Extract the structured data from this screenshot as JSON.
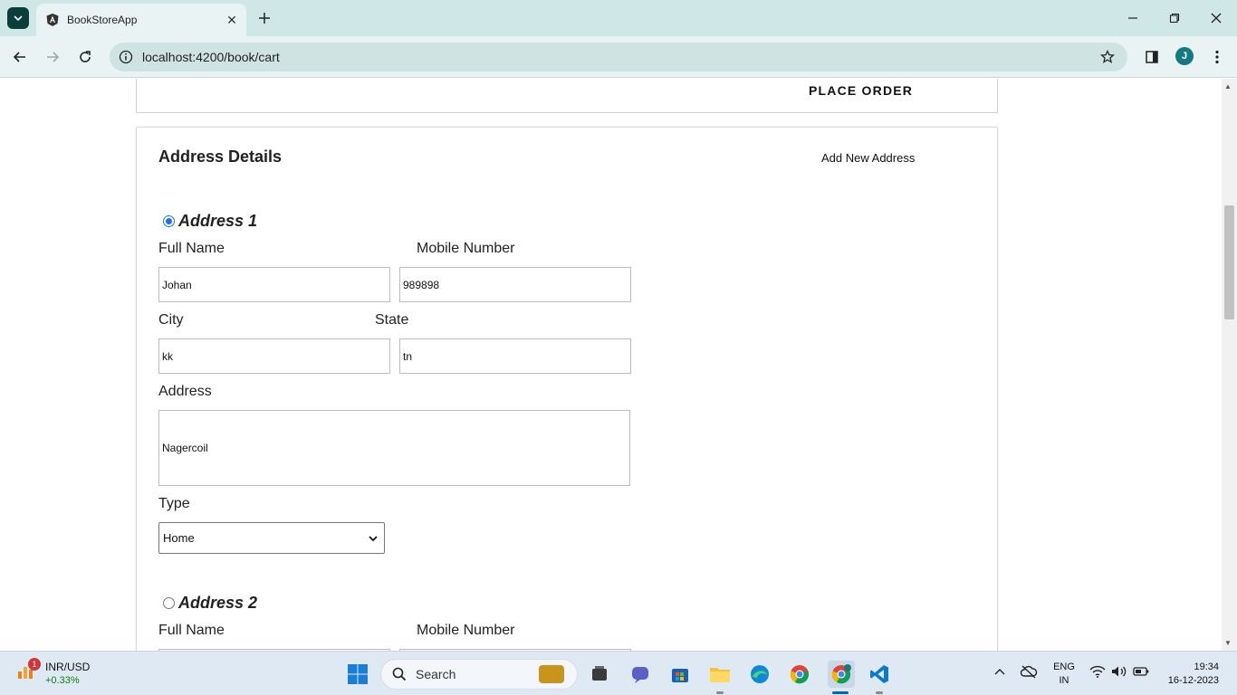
{
  "browser": {
    "tab_title": "BookStoreApp",
    "url": "localhost:4200/book/cart",
    "profile_initial": "J"
  },
  "page": {
    "place_order_label": "PLACE ORDER",
    "section_title": "Address Details",
    "add_address_label": "Add New Address",
    "labels": {
      "full_name": "Full Name",
      "mobile": "Mobile Number",
      "city": "City",
      "state": "State",
      "address": "Address",
      "type": "Type"
    },
    "addresses": [
      {
        "heading": "Address 1",
        "selected": true,
        "full_name": "Johan",
        "mobile": "989898",
        "city": "kk",
        "state": "tn",
        "address": "Nagercoil",
        "type": "Home"
      },
      {
        "heading": "Address 2",
        "selected": false
      }
    ]
  },
  "taskbar": {
    "widget_title": "INR/USD",
    "widget_change": "+0.33%",
    "widget_badge": "1",
    "search_placeholder": "Search",
    "lang_line1": "ENG",
    "lang_line2": "IN",
    "time": "19:34",
    "date": "16-12-2023"
  },
  "colors": {
    "accent": "#1a73e8",
    "chrome_bg": "#cfe7e7",
    "positive": "#107c10"
  }
}
